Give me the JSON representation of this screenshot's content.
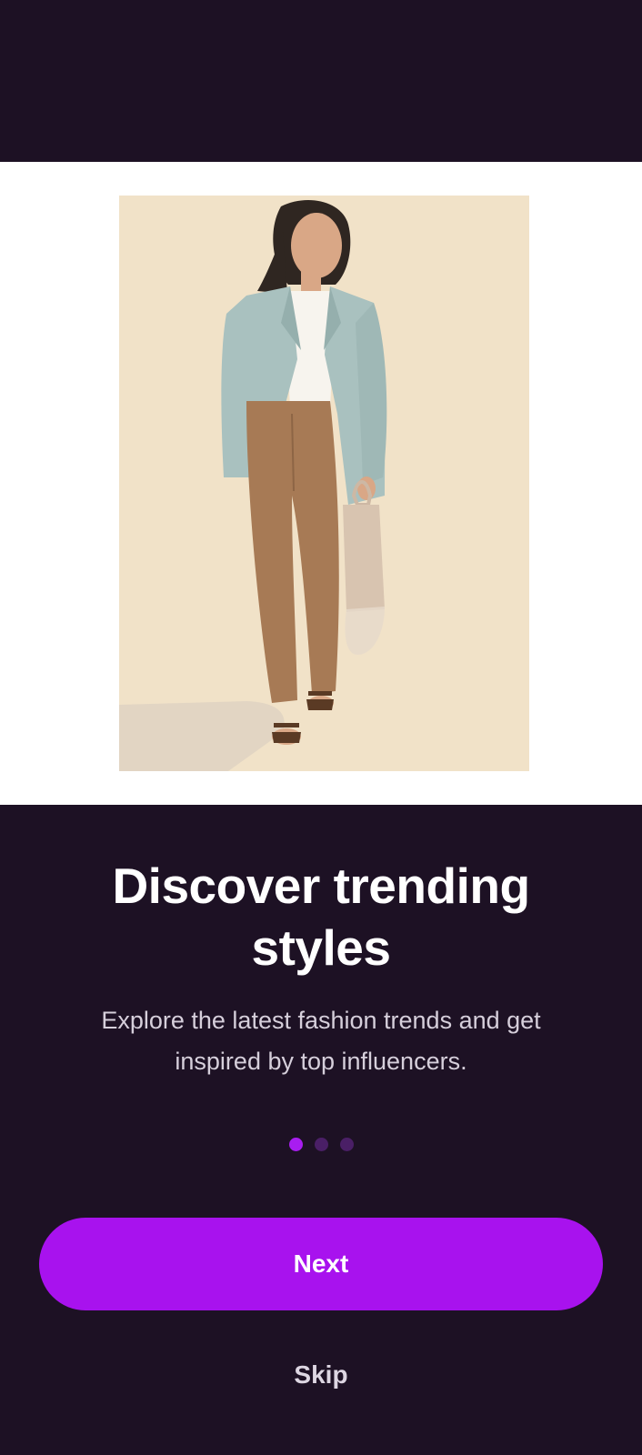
{
  "onboarding": {
    "title": "Discover trending styles",
    "subtitle": "Explore the latest fashion trends and get inspired by top influencers.",
    "page_indicator": {
      "current": 1,
      "total": 3
    },
    "next_label": "Next",
    "skip_label": "Skip"
  },
  "colors": {
    "background": "#1d1124",
    "accent": "#a812ee",
    "dot_inactive": "#4a1f66",
    "hero_band": "#ffffff",
    "art_background": "#f1e2c8"
  }
}
